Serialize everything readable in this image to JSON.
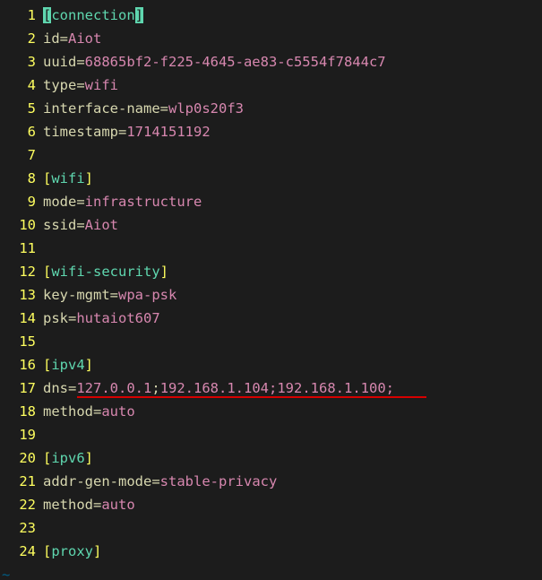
{
  "lines": [
    {
      "n": 1,
      "seg": [
        {
          "t": "[",
          "c": "cursor-l"
        },
        {
          "t": "connection",
          "c": "sec"
        },
        {
          "t": "]",
          "c": "cursor-r"
        }
      ]
    },
    {
      "n": 2,
      "seg": [
        {
          "t": "id",
          "c": "key"
        },
        {
          "t": "=",
          "c": "eq"
        },
        {
          "t": "Aiot",
          "c": "val"
        }
      ]
    },
    {
      "n": 3,
      "seg": [
        {
          "t": "uuid",
          "c": "key"
        },
        {
          "t": "=",
          "c": "eq"
        },
        {
          "t": "68865bf2-f225-4645-ae83-c5554f7844c7",
          "c": "val"
        }
      ]
    },
    {
      "n": 4,
      "seg": [
        {
          "t": "type",
          "c": "key"
        },
        {
          "t": "=",
          "c": "eq"
        },
        {
          "t": "wifi",
          "c": "val"
        }
      ]
    },
    {
      "n": 5,
      "seg": [
        {
          "t": "interface-name",
          "c": "key"
        },
        {
          "t": "=",
          "c": "eq"
        },
        {
          "t": "wlp0s20f3",
          "c": "val"
        }
      ]
    },
    {
      "n": 6,
      "seg": [
        {
          "t": "timestamp",
          "c": "key"
        },
        {
          "t": "=",
          "c": "eq"
        },
        {
          "t": "1714151192",
          "c": "val"
        }
      ]
    },
    {
      "n": 7,
      "seg": []
    },
    {
      "n": 8,
      "seg": [
        {
          "t": "[",
          "c": "bracket"
        },
        {
          "t": "wifi",
          "c": "sec"
        },
        {
          "t": "]",
          "c": "bracket"
        }
      ]
    },
    {
      "n": 9,
      "seg": [
        {
          "t": "mode",
          "c": "key"
        },
        {
          "t": "=",
          "c": "eq"
        },
        {
          "t": "infrastructure",
          "c": "val"
        }
      ]
    },
    {
      "n": 10,
      "seg": [
        {
          "t": "ssid",
          "c": "key"
        },
        {
          "t": "=",
          "c": "eq"
        },
        {
          "t": "Aiot",
          "c": "val"
        }
      ]
    },
    {
      "n": 11,
      "seg": []
    },
    {
      "n": 12,
      "seg": [
        {
          "t": "[",
          "c": "bracket"
        },
        {
          "t": "wifi-security",
          "c": "sec"
        },
        {
          "t": "]",
          "c": "bracket"
        }
      ]
    },
    {
      "n": 13,
      "seg": [
        {
          "t": "key-mgmt",
          "c": "key"
        },
        {
          "t": "=",
          "c": "eq"
        },
        {
          "t": "wpa-psk",
          "c": "val"
        }
      ]
    },
    {
      "n": 14,
      "seg": [
        {
          "t": "psk",
          "c": "key"
        },
        {
          "t": "=",
          "c": "eq"
        },
        {
          "t": "hutaiot607",
          "c": "val"
        }
      ]
    },
    {
      "n": 15,
      "seg": []
    },
    {
      "n": 16,
      "seg": [
        {
          "t": "[",
          "c": "bracket"
        },
        {
          "t": "ipv4",
          "c": "sec"
        },
        {
          "t": "]",
          "c": "bracket"
        }
      ]
    },
    {
      "n": 17,
      "underline": true,
      "seg": [
        {
          "t": "dns",
          "c": "key"
        },
        {
          "t": "=",
          "c": "eq"
        },
        {
          "t": "127.0.0.1",
          "c": "val"
        },
        {
          "t": ";",
          "c": "key"
        },
        {
          "t": "192.168.1.104;192.168.1.100;",
          "c": "val"
        }
      ]
    },
    {
      "n": 18,
      "seg": [
        {
          "t": "method",
          "c": "key"
        },
        {
          "t": "=",
          "c": "eq"
        },
        {
          "t": "auto",
          "c": "val"
        }
      ]
    },
    {
      "n": 19,
      "seg": []
    },
    {
      "n": 20,
      "seg": [
        {
          "t": "[",
          "c": "bracket"
        },
        {
          "t": "ipv6",
          "c": "sec"
        },
        {
          "t": "]",
          "c": "bracket"
        }
      ]
    },
    {
      "n": 21,
      "seg": [
        {
          "t": "addr-gen-mode",
          "c": "key"
        },
        {
          "t": "=",
          "c": "eq"
        },
        {
          "t": "stable-privacy",
          "c": "val"
        }
      ]
    },
    {
      "n": 22,
      "seg": [
        {
          "t": "method",
          "c": "key"
        },
        {
          "t": "=",
          "c": "eq"
        },
        {
          "t": "auto",
          "c": "val"
        }
      ]
    },
    {
      "n": 23,
      "seg": []
    },
    {
      "n": 24,
      "seg": [
        {
          "t": "[",
          "c": "bracket"
        },
        {
          "t": "proxy",
          "c": "sec"
        },
        {
          "t": "]",
          "c": "bracket"
        }
      ]
    }
  ],
  "tilde": "~"
}
